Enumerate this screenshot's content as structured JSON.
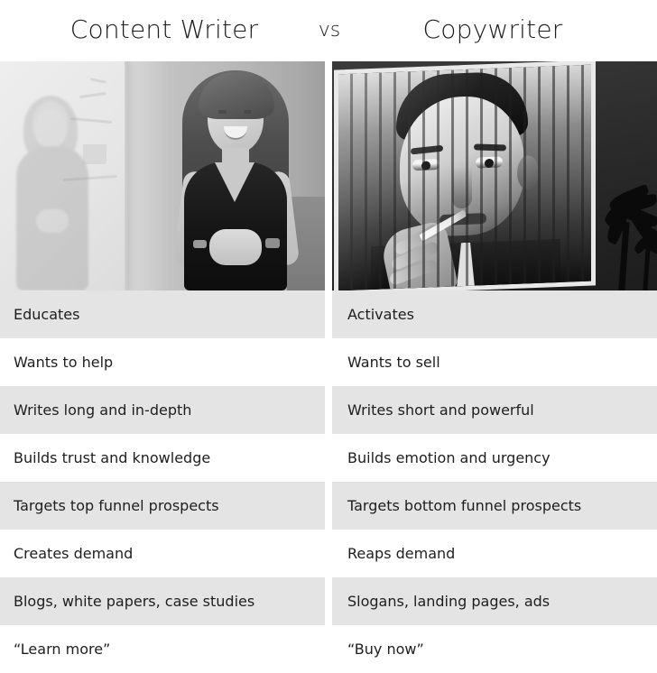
{
  "header": {
    "left_title": "Content Writer",
    "versus": "vs",
    "right_title": "Copywriter"
  },
  "photos": {
    "left": {
      "alt": "Smiling woman standing beside a whiteboard with hands clasped, black-and-white photo",
      "subject": "content-writer-photo"
    },
    "right": {
      "alt": "Black-and-white billboard poster of a man smoking a cigarette, seen behind vertical slats with a palm tree at right",
      "subject": "copywriter-photo"
    }
  },
  "comparison": {
    "columns": [
      "Content Writer",
      "Copywriter"
    ],
    "rows": [
      {
        "left": "Educates",
        "right": "Activates",
        "shaded": true
      },
      {
        "left": "Wants to help",
        "right": "Wants to sell",
        "shaded": false
      },
      {
        "left": "Writes long and in-depth",
        "right": "Writes short and powerful",
        "shaded": true
      },
      {
        "left": "Builds trust and knowledge",
        "right": "Builds emotion and urgency",
        "shaded": false
      },
      {
        "left": "Targets top funnel prospects",
        "right": "Targets bottom funnel prospects",
        "shaded": true
      },
      {
        "left": "Creates demand",
        "right": "Reaps demand",
        "shaded": false
      },
      {
        "left": "Blogs, white papers, case studies",
        "right": "Slogans, landing pages, ads",
        "shaded": true
      },
      {
        "left": "“Learn more”",
        "right": "“Buy now”",
        "shaded": false
      }
    ]
  },
  "colors": {
    "page_background": "#ffffff",
    "row_shaded": "#e4e4e4",
    "row_plain": "#ffffff",
    "text": "#1e1e1e",
    "title_text": "#1c1c1c"
  }
}
